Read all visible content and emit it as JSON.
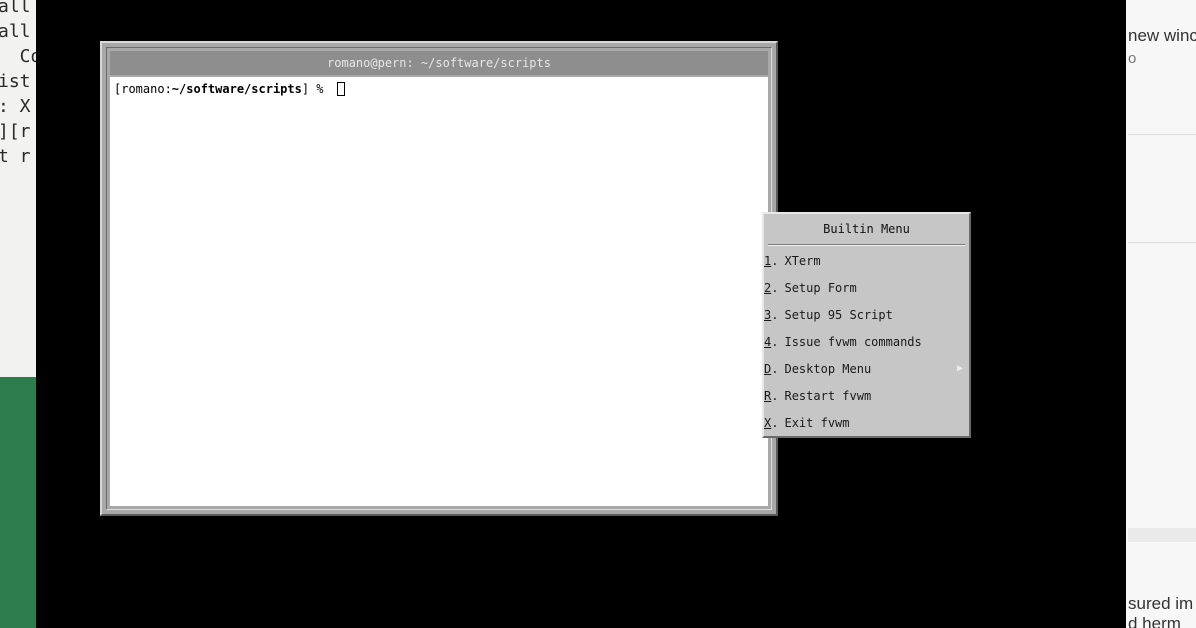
{
  "left_bg": {
    "lines": [
      "all",
      "all",
      "  Co",
      "ist",
      ": X",
      "][r",
      "t r"
    ]
  },
  "right_bg": {
    "text1": "new winc",
    "text2": "o",
    "text3": "sured im",
    "text4": "d herm"
  },
  "xterm": {
    "title": "romano@pern: ~/software/scripts",
    "prompt_user": "[romano:",
    "prompt_path": "~/software/scripts",
    "prompt_end": "] % "
  },
  "menu": {
    "title": "Builtin Menu",
    "items": [
      {
        "key": "1",
        "label": "XTerm"
      },
      {
        "key": "2",
        "label": "Setup Form"
      },
      {
        "key": "3",
        "label": "Setup 95 Script"
      },
      {
        "key": "4",
        "label": "Issue fvwm commands"
      },
      {
        "key": "D",
        "label": "Desktop Menu"
      },
      {
        "key": "R",
        "label": "Restart fvwm"
      },
      {
        "key": "X",
        "label": "Exit fvwm"
      }
    ]
  }
}
